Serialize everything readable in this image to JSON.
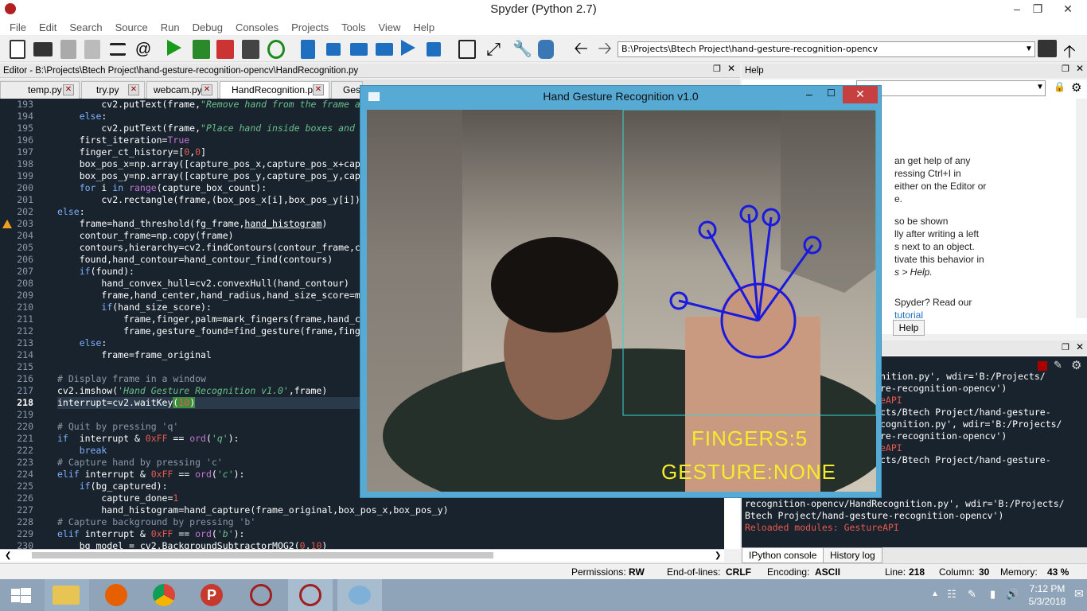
{
  "window": {
    "title": "Spyder (Python 2.7)"
  },
  "menu": [
    "File",
    "Edit",
    "Search",
    "Source",
    "Run",
    "Debug",
    "Consoles",
    "Projects",
    "Tools",
    "View",
    "Help"
  ],
  "toolbar": {
    "path": "B:\\Projects\\Btech Project\\hand-gesture-recognition-opencv"
  },
  "editor": {
    "header": "Editor - B:\\Projects\\Btech Project\\hand-gesture-recognition-opencv\\HandRecognition.py",
    "tabs": [
      "temp.py",
      "try.py",
      "webcam.py",
      "HandRecognition.py",
      "Gest"
    ],
    "active_tab": "HandRecognition.py",
    "current_line": "218",
    "warning_line": "203",
    "line_numbers": [
      "193",
      "194",
      "195",
      "196",
      "197",
      "198",
      "199",
      "200",
      "201",
      "202",
      "203",
      "204",
      "205",
      "206",
      "207",
      "208",
      "209",
      "210",
      "211",
      "212",
      "213",
      "214",
      "215",
      "216",
      "217",
      "218",
      "219",
      "220",
      "221",
      "222",
      "223",
      "224",
      "225",
      "226",
      "227",
      "228",
      "229",
      "230"
    ]
  },
  "help": {
    "header": "Help",
    "text": [
      "an get help of any",
      "ressing Ctrl+I in",
      "either on the Editor or",
      "e.",
      "so be shown",
      "lly after writing a left",
      "s next to an object.",
      "tivate this behavior in",
      "s > Help.",
      "Spyder? Read our",
      "tutorial"
    ],
    "button": "Help"
  },
  "console": {
    "tabs": [
      "IPython console",
      "History log"
    ],
    "lines": [
      "nition.py', wdir='B:/Projects/",
      "re-recognition-opencv')",
      "eAPI",
      "",
      "cts/Btech Project/hand-gesture-",
      "cognition.py', wdir='B:/Projects/",
      "re-recognition-opencv')",
      "eAPI",
      "",
      "cts/Btech Project/hand-gesture-",
      "recognition-opencv/HandRecognition.py', wdir='B:/Projects/",
      "Btech Project/hand-gesture-recognition-opencv')",
      "Reloaded modules: GestureAPI"
    ]
  },
  "status": {
    "permissions_label": "Permissions:",
    "permissions": "RW",
    "eol_label": "End-of-lines:",
    "eol": "CRLF",
    "encoding_label": "Encoding:",
    "encoding": "ASCII",
    "line_label": "Line:",
    "line": "218",
    "column_label": "Column:",
    "column": "30",
    "memory_label": "Memory:",
    "memory": "43 %"
  },
  "overlay": {
    "title": "Hand Gesture Recognition v1.0",
    "fingers": "FINGERS:5",
    "gesture": "GESTURE:NONE"
  },
  "taskbar": {
    "time": "7:12 PM",
    "date": "5/3/2018"
  }
}
